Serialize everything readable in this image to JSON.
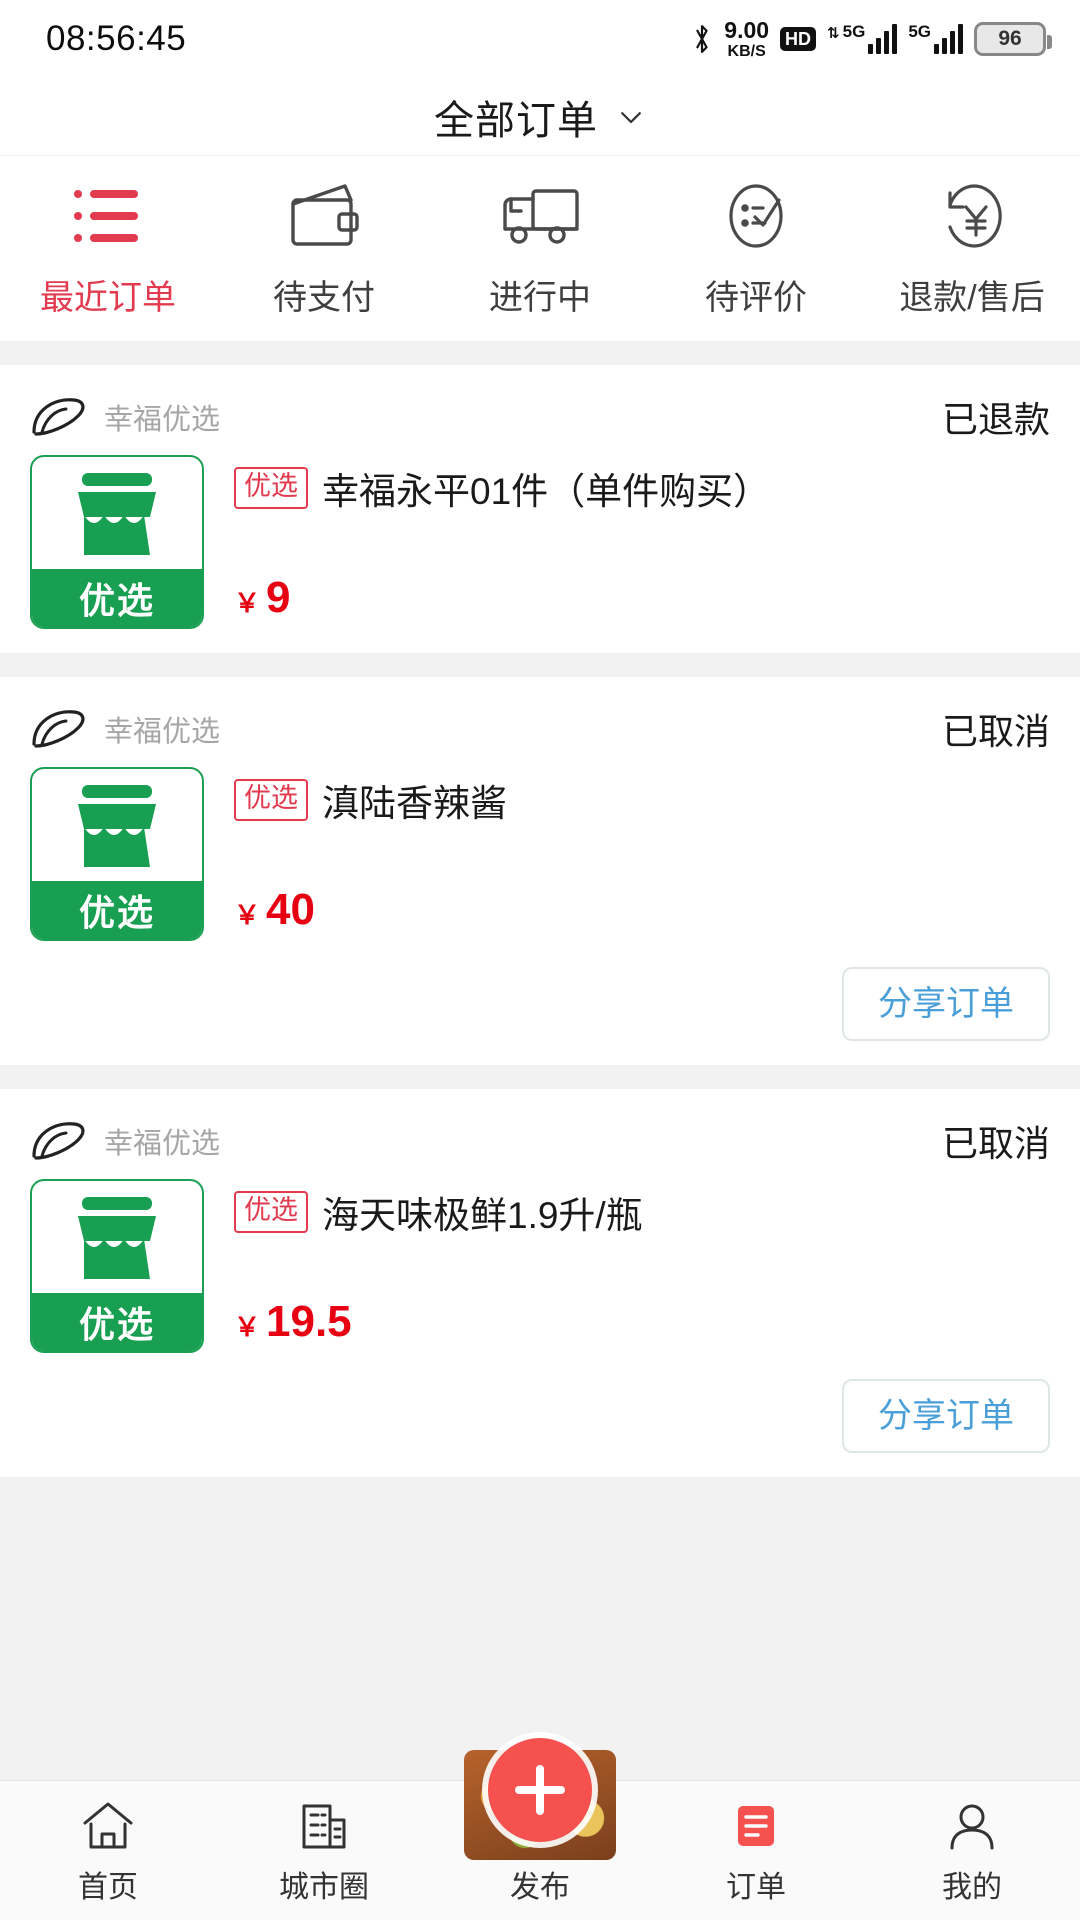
{
  "status_bar": {
    "time": "08:56:45",
    "net_speed_value": "9.00",
    "net_speed_unit": "KB/S",
    "hd_label": "HD",
    "sim1_label": "5G",
    "sim2_label": "5G",
    "battery": "96"
  },
  "header": {
    "title": "全部订单"
  },
  "category_tabs": [
    {
      "label": "最近订单",
      "icon": "list-icon",
      "active": true
    },
    {
      "label": "待支付",
      "icon": "wallet-icon",
      "active": false
    },
    {
      "label": "进行中",
      "icon": "truck-icon",
      "active": false
    },
    {
      "label": "待评价",
      "icon": "review-icon",
      "active": false
    },
    {
      "label": "退款/售后",
      "icon": "refund-icon",
      "active": false
    }
  ],
  "orders": [
    {
      "shop": "幸福优选",
      "status": "已退款",
      "badge": "优选",
      "product": "幸福永平01件（单件购买）",
      "currency": "￥",
      "price": "9",
      "thumb_label": "优选",
      "share_button": null
    },
    {
      "shop": "幸福优选",
      "status": "已取消",
      "badge": "优选",
      "product": "滇陆香辣酱",
      "currency": "￥",
      "price": "40",
      "thumb_label": "优选",
      "share_button": "分享订单"
    },
    {
      "shop": "幸福优选",
      "status": "已取消",
      "badge": "优选",
      "product": "海天味极鲜1.9升/瓶",
      "currency": "￥",
      "price": "19.5",
      "thumb_label": "优选",
      "share_button": "分享订单"
    }
  ],
  "bottom_nav": [
    {
      "label": "首页",
      "icon": "home-icon",
      "active": false
    },
    {
      "label": "城市圈",
      "icon": "city-icon",
      "active": false
    },
    {
      "label": "发布",
      "icon": "plus-icon",
      "active": false
    },
    {
      "label": "订单",
      "icon": "order-icon",
      "active": true
    },
    {
      "label": "我的",
      "icon": "person-icon",
      "active": false
    }
  ],
  "colors": {
    "accent_red": "#e23a4e",
    "price_red": "#e60012",
    "brand_green": "#199f51",
    "link_blue": "#4a9fd8",
    "page_bg": "#f2f2f2"
  }
}
